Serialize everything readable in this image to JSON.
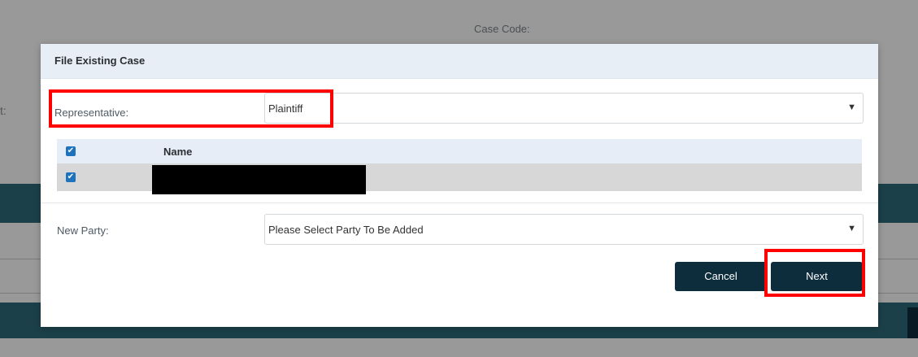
{
  "background": {
    "case_code_label": "Case Code:",
    "left_fragment": "t:"
  },
  "modal": {
    "title": "File Existing Case",
    "representative": {
      "label": "Representative:",
      "value": "Plaintiff"
    },
    "table": {
      "header": {
        "name": "Name",
        "checked": true
      },
      "rows": [
        {
          "checked": true,
          "name_redacted": true
        }
      ]
    },
    "new_party": {
      "label": "New Party:",
      "placeholder": "Please Select Party To Be Added"
    },
    "buttons": {
      "cancel": "Cancel",
      "next": "Next"
    }
  },
  "icons": {
    "dropdown": "chevron-down-icon",
    "checkbox": "checkmark-icon"
  },
  "colors": {
    "primary_button": "#0d2d3d",
    "checkbox": "#1e73be",
    "highlight": "#ff0000",
    "header_bg": "#e8eef6"
  }
}
